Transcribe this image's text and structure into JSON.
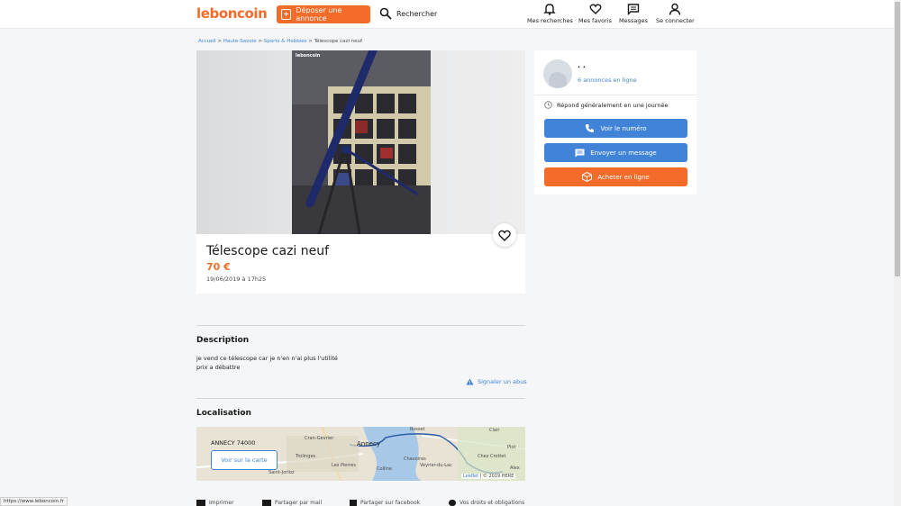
{
  "header": {
    "logo": "leboncoin",
    "post_ad": "Déposer une annonce",
    "search": "Rechercher",
    "nav": {
      "searches": "Mes recherches",
      "favorites": "Mes favoris",
      "messages": "Messages",
      "login": "Se connecter"
    }
  },
  "breadcrumb": {
    "home": "Accueil",
    "region": "Haute-Savoie",
    "category": "Sports & Hobbies",
    "current": "Télescope cazi neuf",
    "sep": ">"
  },
  "photo": {
    "watermark": "leboncoin"
  },
  "ad": {
    "title": "Télescope cazi neuf",
    "price": "70 €",
    "date": "19/06/2019 à 17h25"
  },
  "description": {
    "heading": "Description",
    "line1": "je vend ce télescope car je n'en n'ai plus l'utilité",
    "line2": "prix a débattre",
    "report": "Signaler un abus"
  },
  "location": {
    "heading": "Localisation",
    "city": "ANNECY 74000",
    "map_button": "Voir sur la carte",
    "attribution_link": "Leaflet",
    "attribution_text": "| © 2019 HERE",
    "map_labels": [
      "Annecy",
      "Cran-Gevrier",
      "Veyrier-du-Lac",
      "Chavoires",
      "Alex",
      "Clair",
      "Plot",
      "Trolinges",
      "Colline",
      "Rosset",
      "Chez Crottet",
      "Les Pierres",
      "Saint-Jorioz"
    ]
  },
  "footer": {
    "print": "Imprimer",
    "share_email": "Partager par mail",
    "share_facebook": "Partager sur facebook",
    "rights": "Vos droits et obligations"
  },
  "seller": {
    "name": "· ·",
    "ads": "6 annonces en ligne",
    "respond": "Répond généralement en une journée",
    "btn_number": "Voir le numéro",
    "btn_message": "Envoyer un message",
    "btn_buy": "Acheter en ligne"
  },
  "status_url": "https://www.leboncoin.fr",
  "colors": {
    "brand": "#f56b2a",
    "link": "#4183d7"
  }
}
